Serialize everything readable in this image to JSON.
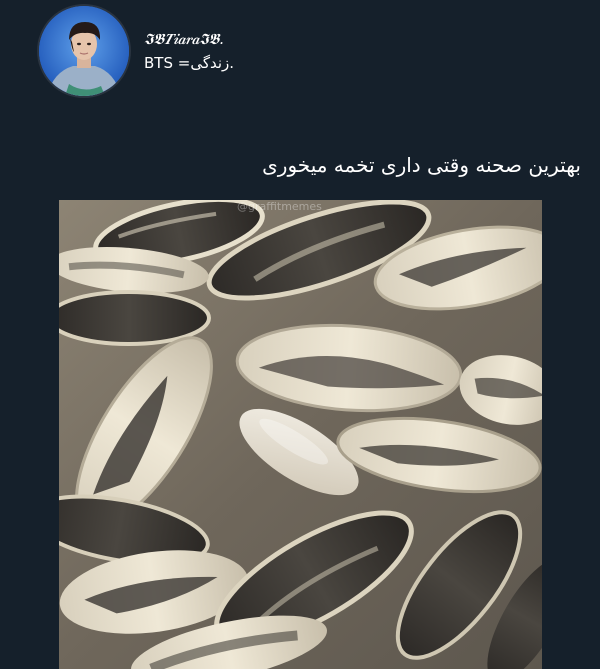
{
  "post": {
    "display_name": "𝕴𝕭𝑻𝒊𝒂𝒓𝒂𝕴𝕭.",
    "handle_text": "BTS =زندگی.",
    "text": "بهترین صحنه وقتی داری تخمه میخوری"
  },
  "media": {
    "watermark": "@graffitmemes"
  },
  "colors": {
    "background": "#15202b",
    "text": "#ffffff",
    "avatar_bg": "#2f6fd0"
  }
}
